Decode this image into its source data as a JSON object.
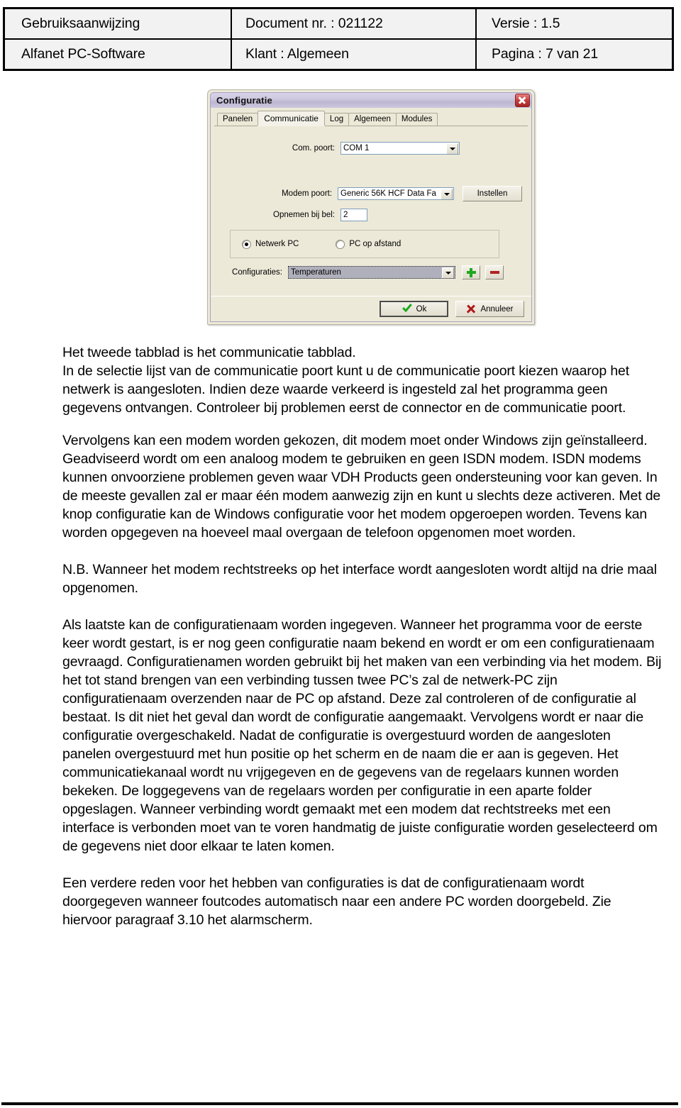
{
  "header": {
    "row1": {
      "doc_type": "Gebruiksaanwijzing",
      "doc_number": "Document nr. : 021122",
      "version": "Versie : 1.5"
    },
    "row2": {
      "product": "Alfanet PC-Software",
      "client": "Klant : Algemeen",
      "page": "Pagina : 7 van 21"
    }
  },
  "dialog": {
    "title": "Configuratie",
    "close_label": "close-icon",
    "tabs": [
      {
        "label": "Panelen",
        "active": false
      },
      {
        "label": "Communicatie",
        "active": true
      },
      {
        "label": "Log",
        "active": false
      },
      {
        "label": "Algemeen",
        "active": false
      },
      {
        "label": "Modules",
        "active": false
      }
    ],
    "fields": {
      "com_poort_label": "Com. poort:",
      "com_poort_value": "COM 1",
      "modem_poort_label": "Modem poort:",
      "modem_poort_value": "Generic 56K HCF Data Fa",
      "instellen_button": "Instellen",
      "opnemen_label": "Opnemen bij bel:",
      "opnemen_value": "2",
      "radio_netwerk": "Netwerk PC",
      "radio_afstand": "PC op afstand",
      "configuraties_label": "Configuraties:",
      "configuraties_value": "Temperaturen",
      "add_button": "+",
      "remove_button": "–"
    },
    "buttons": {
      "ok": "Ok",
      "cancel": "Annuleer"
    }
  },
  "body": {
    "p1_line1": "Het tweede tabblad is het communicatie tabblad.",
    "p1_line2": "In de selectie lijst van de communicatie poort kunt u de communicatie poort kiezen waarop het netwerk is aangesloten. Indien deze waarde verkeerd is ingesteld zal het programma geen gegevens ontvangen. Controleer bij problemen eerst de connector en de communicatie poort.",
    "p2": "Vervolgens kan een modem worden gekozen, dit modem moet onder Windows zijn geïnstalleerd. Geadviseerd wordt om een analoog modem te gebruiken en geen ISDN modem. ISDN modems kunnen onvoorziene problemen geven waar VDH Products geen ondersteuning voor kan geven. In de meeste gevallen zal er maar één modem aanwezig zijn en kunt u slechts deze activeren. Met de knop configuratie kan de Windows configuratie voor het modem opgeroepen worden. Tevens kan worden opgegeven na hoeveel maal overgaan de telefoon opgenomen moet worden.",
    "p3": "N.B. Wanneer het modem rechtstreeks op het interface wordt aangesloten wordt altijd na drie maal opgenomen.",
    "p4": "Als laatste kan de configuratienaam worden ingegeven. Wanneer het programma voor de eerste keer wordt gestart, is er nog geen configuratie naam bekend en wordt er om een configuratienaam gevraagd. Configuratienamen worden gebruikt bij het maken van een verbinding via het modem. Bij het tot stand brengen van een verbinding tussen twee PC’s zal de netwerk-PC zijn configuratienaam overzenden naar de PC op afstand. Deze zal controleren of de configuratie al bestaat. Is dit niet het geval dan wordt de configuratie aangemaakt. Vervolgens wordt er naar die configuratie overgeschakeld. Nadat de configuratie is overgestuurd worden de aangesloten panelen overgestuurd met hun positie op het scherm en de naam die er aan is gegeven. Het communicatiekanaal wordt nu vrijgegeven en de gegevens van de regelaars kunnen worden bekeken. De loggegevens van de regelaars worden per configuratie in een aparte folder opgeslagen. Wanneer verbinding wordt gemaakt met een modem dat rechtstreeks met een interface is verbonden moet van te voren handmatig de juiste configuratie worden geselecteerd om de gegevens niet door elkaar te laten komen.",
    "p5": "Een verdere reden voor het hebben van configuraties is dat de configuratienaam wordt doorgegeven wanneer foutcodes automatisch naar een andere PC worden doorgebeld. Zie hiervoor paragraaf 3.10 het alarmscherm."
  },
  "colors": {
    "dialog_face": "#ece9d8",
    "title_gradient_start": "#d8d3e8",
    "title_gradient_end": "#bdb6d2",
    "close_red": "#c23b3b",
    "plus_green": "#1fa81f",
    "minus_red": "#b02222",
    "ok_check_green": "#1ba81b",
    "cancel_x_red": "#b01818",
    "combo_selected_bg": "#b0b0bc"
  }
}
